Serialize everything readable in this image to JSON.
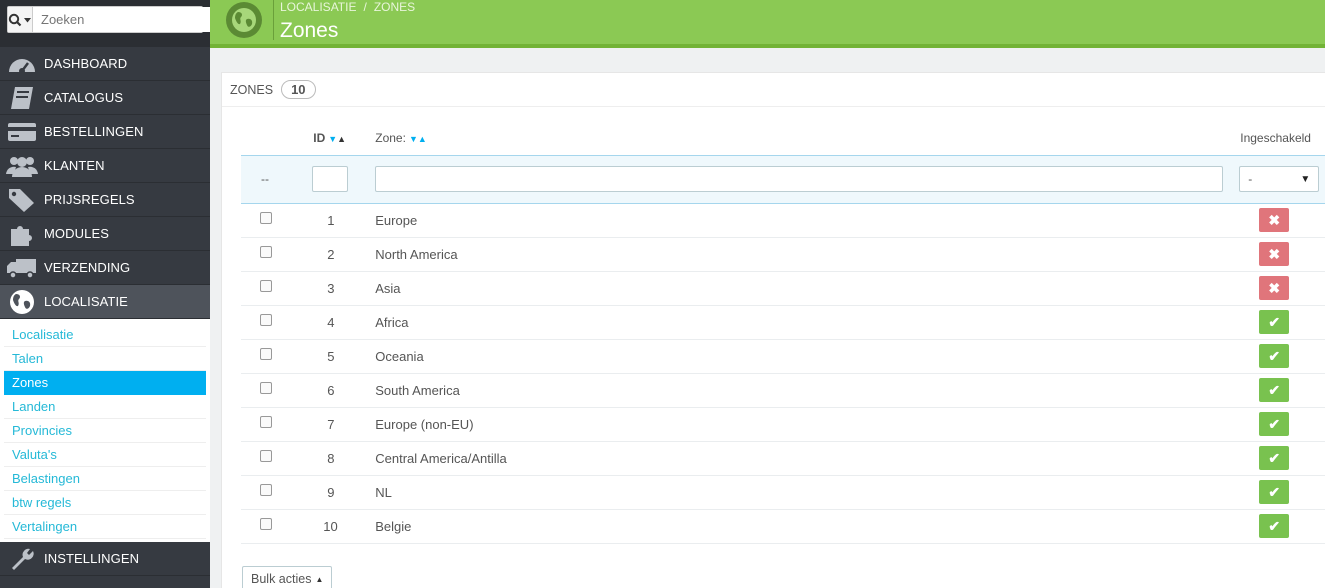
{
  "search": {
    "placeholder": "Zoeken"
  },
  "nav": [
    {
      "label": "DASHBOARD",
      "icon": "dashboard-icon"
    },
    {
      "label": "CATALOGUS",
      "icon": "book-icon"
    },
    {
      "label": "BESTELLINGEN",
      "icon": "credit-card-icon"
    },
    {
      "label": "KLANTEN",
      "icon": "users-icon"
    },
    {
      "label": "PRIJSREGELS",
      "icon": "tags-icon"
    },
    {
      "label": "MODULES",
      "icon": "puzzle-icon"
    },
    {
      "label": "VERZENDING",
      "icon": "truck-icon"
    },
    {
      "label": "LOCALISATIE",
      "icon": "globe-icon"
    }
  ],
  "submenu": [
    "Localisatie",
    "Talen",
    "Zones",
    "Landen",
    "Provincies",
    "Valuta's",
    "Belastingen",
    "btw regels",
    "Vertalingen"
  ],
  "nav_bottom": {
    "label": "INSTELLINGEN",
    "icon": "wrench-icon"
  },
  "header": {
    "breadcrumb_1": "LOCALISATIE",
    "breadcrumb_sep": "/",
    "breadcrumb_2": "ZONES",
    "title": "Zones"
  },
  "panel": {
    "title": "ZONES",
    "count": "10"
  },
  "table": {
    "col_id": "ID",
    "col_zone": "Zone:",
    "col_enabled": "Ingeschakeld",
    "filter_dash": "--",
    "filter_select_value": "-",
    "rows": [
      {
        "id": "1",
        "zone": "Europe",
        "enabled": false
      },
      {
        "id": "2",
        "zone": "North America",
        "enabled": false
      },
      {
        "id": "3",
        "zone": "Asia",
        "enabled": false
      },
      {
        "id": "4",
        "zone": "Africa",
        "enabled": true
      },
      {
        "id": "5",
        "zone": "Oceania",
        "enabled": true
      },
      {
        "id": "6",
        "zone": "South America",
        "enabled": true
      },
      {
        "id": "7",
        "zone": "Europe (non-EU)",
        "enabled": true
      },
      {
        "id": "8",
        "zone": "Central America/Antilla",
        "enabled": true
      },
      {
        "id": "9",
        "zone": "NL",
        "enabled": true
      },
      {
        "id": "10",
        "zone": "Belgie",
        "enabled": true
      }
    ]
  },
  "bulk": {
    "label": "Bulk acties"
  },
  "colors": {
    "header_green": "#8bc954",
    "sidebar": "#363a41",
    "accent": "#00aff0",
    "enabled": "#79c24f",
    "disabled": "#e0757b"
  }
}
